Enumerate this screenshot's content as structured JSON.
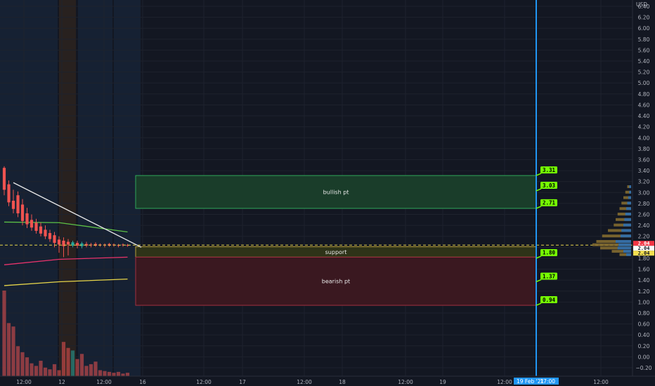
{
  "chart_data": {
    "type": "candlestick",
    "currency": "USD",
    "y_axis": {
      "min": -0.2,
      "max": 6.4,
      "step": 0.2,
      "ticks": [
        "6.40",
        "6.20",
        "6.00",
        "5.80",
        "5.60",
        "5.40",
        "5.20",
        "5.00",
        "4.80",
        "4.60",
        "4.40",
        "4.20",
        "4.00",
        "3.80",
        "3.60",
        "3.40",
        "3.20",
        "3.00",
        "2.80",
        "2.60",
        "2.40",
        "2.20",
        "2.00",
        "1.80",
        "1.60",
        "1.40",
        "1.20",
        "1.00",
        "0.80",
        "0.60",
        "0.40",
        "0.20",
        "0.00",
        "−0.20"
      ]
    },
    "x_axis": {
      "ticks": [
        "12:00",
        "12",
        "12:00",
        "16",
        "12:00",
        "17",
        "12:00",
        "18",
        "12:00",
        "19",
        "12:00",
        "12:00"
      ],
      "cursor_date": "19 Feb '21",
      "cursor_time": "17:00"
    },
    "current_price": 2.04,
    "last_price_labels": [
      {
        "text": "2.04",
        "color": "#f23645",
        "text_color": "#ffffff"
      },
      {
        "text": "2.04",
        "color": "#ffffff",
        "text_color": "#131722"
      },
      {
        "text": "2.04",
        "color": "#f5e050",
        "text_color": "#131722"
      }
    ],
    "zones": [
      {
        "label": "bullish pt",
        "top": 3.31,
        "bottom": 2.71,
        "fill": "#1a3d2a",
        "stroke": "#2fa85a"
      },
      {
        "label": "support",
        "top": 2.01,
        "bottom": 1.82,
        "fill": "#2e3318",
        "stroke": "#b8a03a"
      },
      {
        "label": "bearish pt",
        "top": 1.82,
        "bottom": 0.94,
        "fill": "#3a1820",
        "stroke": "#a33040"
      }
    ],
    "price_targets": [
      3.31,
      3.03,
      2.71,
      1.8,
      1.37,
      0.94
    ],
    "price_target_labels": [
      "3.31",
      "3.03",
      "2.71",
      "1.80",
      "1.37",
      "0.94"
    ],
    "candles": [
      {
        "o": 3.05,
        "h": 3.48,
        "l": 2.95,
        "c": 3.45,
        "bull": false
      },
      {
        "o": 3.15,
        "h": 3.22,
        "l": 2.75,
        "c": 2.82,
        "bull": false
      },
      {
        "o": 2.85,
        "h": 3.05,
        "l": 2.62,
        "c": 2.7,
        "bull": false
      },
      {
        "o": 2.95,
        "h": 3.02,
        "l": 2.55,
        "c": 2.62,
        "bull": false
      },
      {
        "o": 2.78,
        "h": 2.88,
        "l": 2.4,
        "c": 2.48,
        "bull": false
      },
      {
        "o": 2.62,
        "h": 2.72,
        "l": 2.35,
        "c": 2.42,
        "bull": false
      },
      {
        "o": 2.5,
        "h": 2.6,
        "l": 2.3,
        "c": 2.36,
        "bull": false
      },
      {
        "o": 2.45,
        "h": 2.52,
        "l": 2.25,
        "c": 2.3,
        "bull": false
      },
      {
        "o": 2.38,
        "h": 2.45,
        "l": 2.2,
        "c": 2.25,
        "bull": false
      },
      {
        "o": 2.32,
        "h": 2.4,
        "l": 2.15,
        "c": 2.2,
        "bull": false
      },
      {
        "o": 2.26,
        "h": 2.32,
        "l": 2.1,
        "c": 2.15,
        "bull": false
      },
      {
        "o": 2.22,
        "h": 2.28,
        "l": 2.0,
        "c": 2.08,
        "bull": false
      },
      {
        "o": 2.14,
        "h": 2.2,
        "l": 1.9,
        "c": 2.05,
        "bull": false
      },
      {
        "o": 2.12,
        "h": 2.18,
        "l": 1.82,
        "c": 2.02,
        "bull": false
      },
      {
        "o": 2.1,
        "h": 2.15,
        "l": 1.85,
        "c": 2.05,
        "bull": false
      },
      {
        "o": 2.03,
        "h": 2.12,
        "l": 2.0,
        "c": 2.09,
        "bull": true
      },
      {
        "o": 2.08,
        "h": 2.12,
        "l": 1.98,
        "c": 2.03,
        "bull": false
      },
      {
        "o": 2.02,
        "h": 2.1,
        "l": 1.98,
        "c": 2.07,
        "bull": true
      },
      {
        "o": 2.06,
        "h": 2.1,
        "l": 2.0,
        "c": 2.03,
        "bull": false
      },
      {
        "o": 2.05,
        "h": 2.08,
        "l": 2.0,
        "c": 2.04,
        "bull": false
      },
      {
        "o": 2.06,
        "h": 2.09,
        "l": 2.01,
        "c": 2.03,
        "bull": false
      },
      {
        "o": 2.04,
        "h": 2.07,
        "l": 2.01,
        "c": 2.05,
        "bull": false
      },
      {
        "o": 2.05,
        "h": 2.07,
        "l": 2.0,
        "c": 2.04,
        "bull": false
      },
      {
        "o": 2.06,
        "h": 2.08,
        "l": 2.01,
        "c": 2.03,
        "bull": false
      },
      {
        "o": 2.05,
        "h": 2.07,
        "l": 2.01,
        "c": 2.04,
        "bull": false
      },
      {
        "o": 2.04,
        "h": 2.06,
        "l": 2.0,
        "c": 2.03,
        "bull": false
      },
      {
        "o": 2.05,
        "h": 2.07,
        "l": 2.01,
        "c": 2.04,
        "bull": false
      },
      {
        "o": 2.04,
        "h": 2.06,
        "l": 2.01,
        "c": 2.03,
        "bull": false
      }
    ],
    "volume": [
      {
        "v": 1.0,
        "bull": false
      },
      {
        "v": 0.62,
        "bull": false
      },
      {
        "v": 0.58,
        "bull": false
      },
      {
        "v": 0.35,
        "bull": false
      },
      {
        "v": 0.28,
        "bull": false
      },
      {
        "v": 0.22,
        "bull": false
      },
      {
        "v": 0.15,
        "bull": false
      },
      {
        "v": 0.12,
        "bull": false
      },
      {
        "v": 0.18,
        "bull": false
      },
      {
        "v": 0.1,
        "bull": false
      },
      {
        "v": 0.08,
        "bull": false
      },
      {
        "v": 0.14,
        "bull": false
      },
      {
        "v": 0.07,
        "bull": false
      },
      {
        "v": 0.4,
        "bull": false
      },
      {
        "v": 0.33,
        "bull": false
      },
      {
        "v": 0.3,
        "bull": true
      },
      {
        "v": 0.2,
        "bull": false
      },
      {
        "v": 0.26,
        "bull": false
      },
      {
        "v": 0.12,
        "bull": false
      },
      {
        "v": 0.14,
        "bull": false
      },
      {
        "v": 0.17,
        "bull": false
      },
      {
        "v": 0.07,
        "bull": false
      },
      {
        "v": 0.06,
        "bull": false
      },
      {
        "v": 0.05,
        "bull": false
      },
      {
        "v": 0.04,
        "bull": false
      },
      {
        "v": 0.05,
        "bull": false
      },
      {
        "v": 0.03,
        "bull": false
      },
      {
        "v": 0.04,
        "bull": false
      }
    ],
    "moving_averages": [
      {
        "name": "",
        "color": "#5cbf45",
        "values": [
          [
            0,
            2.46
          ],
          [
            12,
            2.45
          ],
          [
            27,
            2.28
          ]
        ]
      },
      {
        "name": "",
        "color": "#e8336b",
        "values": [
          [
            0,
            1.68
          ],
          [
            12,
            1.78
          ],
          [
            27,
            1.82
          ]
        ]
      },
      {
        "name": "",
        "color": "#e5d44a",
        "values": [
          [
            0,
            1.3
          ],
          [
            12,
            1.37
          ],
          [
            27,
            1.42
          ]
        ]
      }
    ],
    "trendline": {
      "start": [
        2,
        3.18
      ],
      "end": [
        30,
        2.0
      ],
      "color": "#e8e8e8"
    },
    "volume_profile": [
      {
        "price": 3.1,
        "buy": 0.1,
        "sell": 0.1
      },
      {
        "price": 3.0,
        "buy": 0.1,
        "sell": 0.15
      },
      {
        "price": 2.9,
        "buy": 0.15,
        "sell": 0.2
      },
      {
        "price": 2.8,
        "buy": 0.2,
        "sell": 0.25
      },
      {
        "price": 2.7,
        "buy": 0.25,
        "sell": 0.3
      },
      {
        "price": 2.6,
        "buy": 0.3,
        "sell": 0.35
      },
      {
        "price": 2.5,
        "buy": 0.35,
        "sell": 0.4
      },
      {
        "price": 2.4,
        "buy": 0.4,
        "sell": 0.45
      },
      {
        "price": 2.3,
        "buy": 0.5,
        "sell": 0.6
      },
      {
        "price": 2.2,
        "buy": 0.55,
        "sell": 0.75
      },
      {
        "price": 2.1,
        "buy": 0.8,
        "sell": 0.9
      },
      {
        "price": 2.04,
        "buy": 0.65,
        "sell": 1.0
      },
      {
        "price": 1.98,
        "buy": 0.7,
        "sell": 0.8
      },
      {
        "price": 1.92,
        "buy": 0.4,
        "sell": 0.5
      },
      {
        "price": 1.86,
        "buy": 0.25,
        "sell": 0.3
      }
    ],
    "colors": {
      "bull": "#26a69a",
      "bear": "#ef5350",
      "background": "#131722",
      "grid": "#1e222d",
      "cursor_line": "#2196f3",
      "highlight": "#76ff03",
      "session_blue": "#1a2a42",
      "session_orange": "#3a2a1e"
    }
  }
}
